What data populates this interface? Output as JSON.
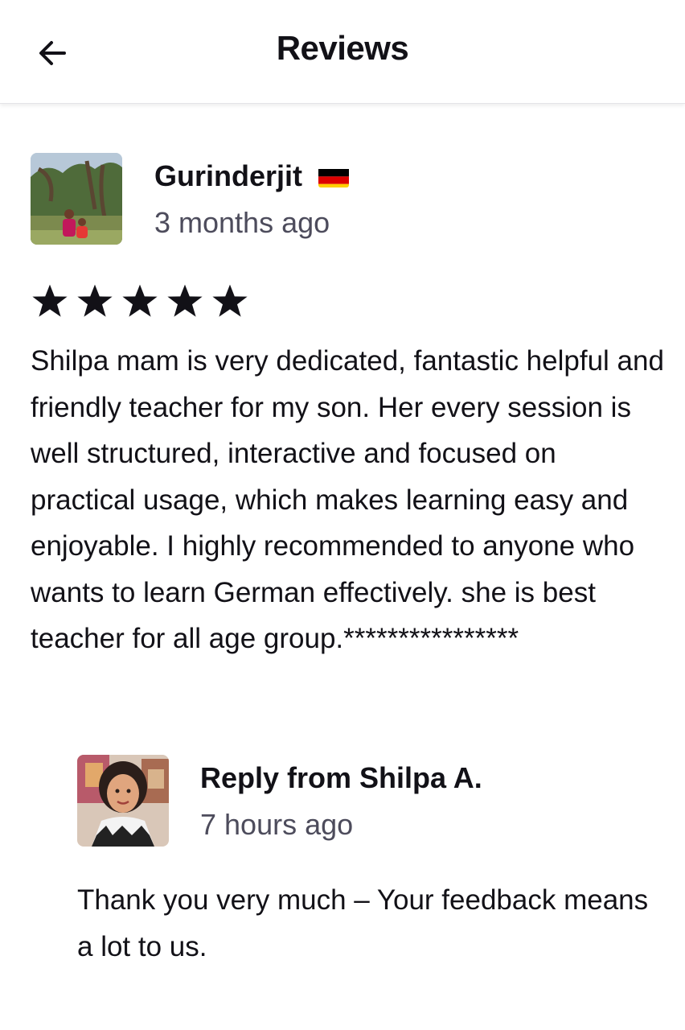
{
  "header": {
    "title": "Reviews",
    "back_icon": "arrow-left-icon"
  },
  "review": {
    "reviewer_name": "Gurinderjit",
    "flag": "germany-flag-icon",
    "time_ago": "3 months ago",
    "rating": 5,
    "max_rating": 5,
    "text": "Shilpa mam is very dedicated, fantastic helpful and friendly teacher for my son. Her every session is well structured, interactive and focused on practical usage, which makes learning easy and enjoyable. I highly recommended to anyone who wants to learn German effectively. she is best teacher for all age group.****************"
  },
  "reply": {
    "title": "Reply from Shilpa A.",
    "time_ago": "7 hours ago",
    "text": "Thank you very much – Your feedback means a lot to us."
  },
  "colors": {
    "text_primary": "#121117",
    "text_secondary": "#4d4c5c",
    "star": "#121117"
  }
}
